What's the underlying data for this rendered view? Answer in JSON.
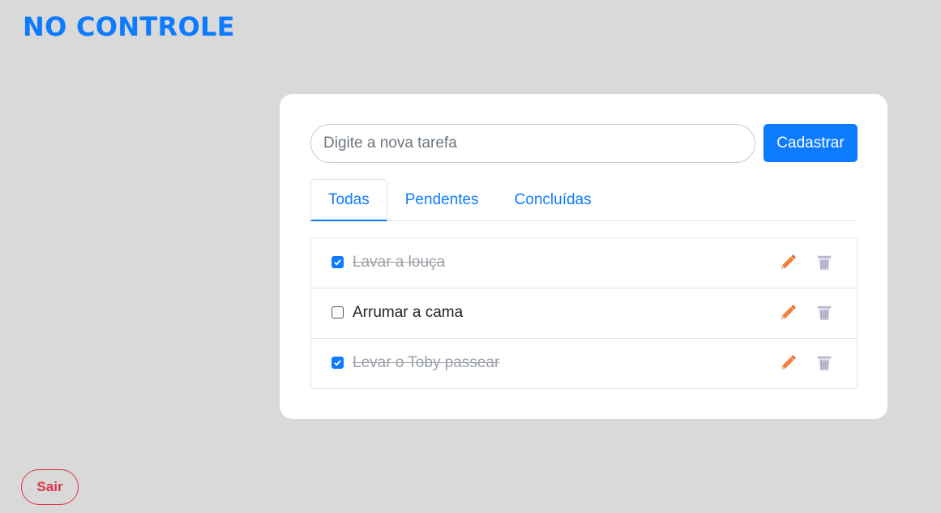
{
  "app": {
    "title": "NO CONTROLE"
  },
  "form": {
    "placeholder": "Digite a nova tarefa",
    "value": "",
    "submit_label": "Cadastrar"
  },
  "tabs": [
    {
      "label": "Todas",
      "active": true
    },
    {
      "label": "Pendentes",
      "active": false
    },
    {
      "label": "Concluídas",
      "active": false
    }
  ],
  "tasks": [
    {
      "text": "Lavar a louça",
      "done": true
    },
    {
      "text": "Arrumar a cama",
      "done": false
    },
    {
      "text": "Levar o Toby passear",
      "done": true
    }
  ],
  "icons": {
    "edit": "pencil-icon",
    "delete": "trash-icon"
  },
  "colors": {
    "accent": "#0d7bff",
    "danger": "#dc3545",
    "edit_icon": "#f0803c",
    "trash_icon": "#b8b5cc"
  },
  "footer": {
    "logout_label": "Sair"
  }
}
